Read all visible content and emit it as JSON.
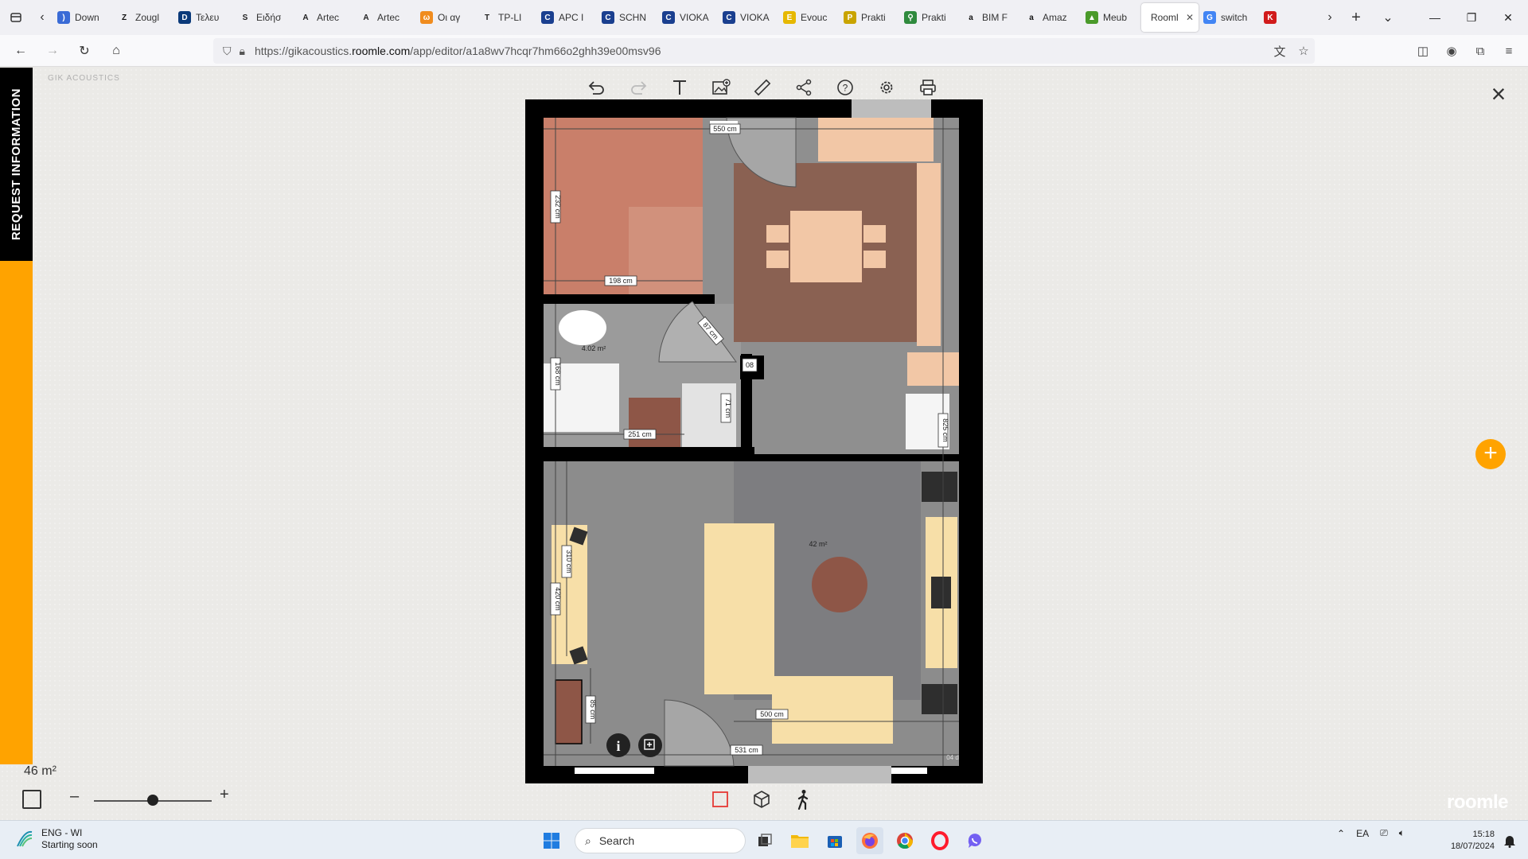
{
  "browser": {
    "tabs": [
      {
        "label": "Down",
        "icon": "sound-icon",
        "color": "#3a6bd6",
        "glyph": ")"
      },
      {
        "label": "Zougl",
        "icon": "z-icon",
        "color": "#111111",
        "glyph": "Z"
      },
      {
        "label": "Τελευ",
        "icon": "d-icon",
        "color": "#0b3a7a",
        "glyph": "D"
      },
      {
        "label": "Ειδήσ",
        "icon": "slc-icon",
        "color": "#222222",
        "glyph": "S"
      },
      {
        "label": "Artec",
        "icon": "artec-icon",
        "color": "#222222",
        "glyph": "A"
      },
      {
        "label": "Artec",
        "icon": "artec-icon",
        "color": "#222222",
        "glyph": "A"
      },
      {
        "label": "Οι αγ",
        "icon": "cat-icon",
        "color": "#f08c1e",
        "glyph": "ω"
      },
      {
        "label": "TP-LI",
        "icon": "tplink-icon",
        "color": "#222222",
        "glyph": "T"
      },
      {
        "label": "APC I",
        "icon": "apc-icon",
        "color": "#1a3f8f",
        "glyph": "C"
      },
      {
        "label": "SCHN",
        "icon": "schn-icon",
        "color": "#1a3f8f",
        "glyph": "C"
      },
      {
        "label": "VIOKA",
        "icon": "vioka-icon",
        "color": "#1a3f8f",
        "glyph": "C"
      },
      {
        "label": "VIOKA",
        "icon": "vioka-icon",
        "color": "#1a3f8f",
        "glyph": "C"
      },
      {
        "label": "Evouc",
        "icon": "evouc-icon",
        "color": "#e6b800",
        "glyph": "E"
      },
      {
        "label": "Prakti",
        "icon": "prakti-icon",
        "color": "#c9a400",
        "glyph": "P"
      },
      {
        "label": "Prakti",
        "icon": "map-pin-icon",
        "color": "#2f8a3d",
        "glyph": "⚲"
      },
      {
        "label": "BIM F",
        "icon": "amazon-icon",
        "color": "#111111",
        "glyph": "a"
      },
      {
        "label": "Amaz",
        "icon": "amazon-icon",
        "color": "#111111",
        "glyph": "a"
      },
      {
        "label": "Meub",
        "icon": "meub-icon",
        "color": "#4a9a2a",
        "glyph": "▲"
      },
      {
        "label": "Rooml",
        "icon": "roomle-icon",
        "color": "#ffffff",
        "glyph": "",
        "active": true
      },
      {
        "label": "switch",
        "icon": "google-icon",
        "color": "#4285f4",
        "glyph": "G"
      },
      {
        "label": "",
        "icon": "k-icon",
        "color": "#d11b1b",
        "glyph": "K"
      }
    ],
    "url_prefix": "https://gikacoustics.",
    "url_domain": "roomle.com",
    "url_path": "/app/editor/a1a8wv7hcqr7hm66o2ghh39e00msv96"
  },
  "app": {
    "request_info": "REQUEST INFORMATION",
    "brand": "GIK ACOUSTICS",
    "area_total": "46 m²",
    "roomle_logo": "roomle",
    "tools": [
      "undo-icon",
      "redo-icon",
      "text-icon",
      "add-image-icon",
      "measure-icon",
      "share-icon",
      "help-icon",
      "settings-icon",
      "print-icon"
    ],
    "zoom": 0.5
  },
  "plan": {
    "labels": {
      "top_width": "550 cm",
      "bedroom_height": "232 cm",
      "bedroom_width": "198 cm",
      "door1": "87 cm",
      "bath_area": "4.02 m²",
      "bath_height": "168 cm",
      "bath_width": "251 cm",
      "bath_small": "71 cm",
      "wall_tag": "08",
      "right_height": "825 cm",
      "living_area": "42 m²",
      "left_310": "310 cm",
      "left_420": "420 cm",
      "left_85": "85 cm",
      "bottom_500": "500 cm",
      "bottom_531": "531 cm",
      "corner_tag": "04 d"
    }
  },
  "taskbar": {
    "weather_line1": "ENG - WI",
    "weather_line2": "Starting soon",
    "search_placeholder": "Search",
    "lang": "EA",
    "time": "15:18",
    "date": "18/07/2024"
  }
}
